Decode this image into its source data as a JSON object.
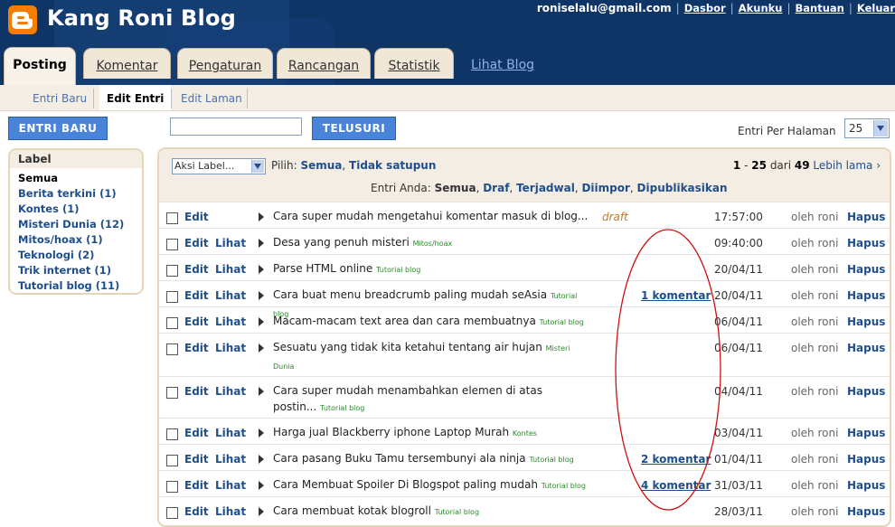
{
  "header": {
    "title": "Kang Roni Blog",
    "email": "roniselalu@gmail.com",
    "links": [
      "Dasbor",
      "Akunku",
      "Bantuan",
      "Keluar"
    ]
  },
  "tabs": [
    "Posting",
    "Komentar",
    "Pengaturan",
    "Rancangan",
    "Statistik"
  ],
  "view_blog": "Lihat Blog",
  "subnav": [
    "Entri Baru",
    "Edit Entri",
    "Edit Laman"
  ],
  "toolbar": {
    "new_post": "ENTRI BARU",
    "search_value": "",
    "search_button": "TELUSURI",
    "per_page_label": "Entri Per Halaman",
    "per_page_value": "25"
  },
  "labels": {
    "heading": "Label",
    "items": [
      "Semua",
      "Berita terkini (1)",
      "Kontes (1)",
      "Misteri Dunia (12)",
      "Mitos/hoax (1)",
      "Teknologi (2)",
      "Trik internet (1)",
      "Tutorial blog (11)"
    ]
  },
  "list_header": {
    "action_select": "Aksi Label...",
    "pilih_label": "Pilih:",
    "select_all": "Semua",
    "select_none": "Tidak satupun",
    "pager_range_start": "1",
    "pager_sep": "-",
    "pager_range_end": "25",
    "pager_of": "dari",
    "pager_total": "49",
    "pager_older": "Lebih lama ›",
    "filter_label": "Entri Anda:",
    "filter_all": "Semua",
    "filters": [
      "Draf",
      "Terjadwal",
      "Diimpor",
      "Dipublikasikan"
    ]
  },
  "actions": {
    "edit": "Edit",
    "view": "Lihat",
    "delete": "Hapus"
  },
  "posts": [
    {
      "title": "Cara super mudah mengetahui komentar masuk di blog...",
      "label": "",
      "status": "draft",
      "comments": "",
      "date": "17:57:00",
      "author": "oleh roni",
      "has_view": false
    },
    {
      "title": "Desa yang penuh misteri",
      "label": "Mitos/hoax",
      "status": "",
      "comments": "",
      "date": "09:40:00",
      "author": "oleh roni",
      "has_view": true
    },
    {
      "title": "Parse HTML online",
      "label": "Tutorial blog",
      "status": "",
      "comments": "",
      "date": "20/04/11",
      "author": "oleh roni",
      "has_view": true
    },
    {
      "title": "Cara buat menu breadcrumb paling mudah seAsia",
      "label": "Tutorial blog",
      "status": "",
      "comments": "1 komentar",
      "date": "20/04/11",
      "author": "oleh roni",
      "has_view": true
    },
    {
      "title": "Macam-macam text area dan cara membuatnya",
      "label": "Tutorial blog",
      "status": "",
      "comments": "",
      "date": "06/04/11",
      "author": "oleh roni",
      "has_view": true
    },
    {
      "title": "Sesuatu yang tidak kita ketahui tentang air hujan",
      "label": "Misteri Dunia",
      "status": "",
      "comments": "",
      "date": "06/04/11",
      "author": "oleh roni",
      "has_view": true
    },
    {
      "title": "Cara super mudah menambahkan elemen di atas postin...",
      "label": "Tutorial blog",
      "status": "",
      "comments": "",
      "date": "04/04/11",
      "author": "oleh roni",
      "has_view": true
    },
    {
      "title": "Harga jual Blackberry iphone Laptop Murah",
      "label": "Kontes",
      "status": "",
      "comments": "",
      "date": "03/04/11",
      "author": "oleh roni",
      "has_view": true
    },
    {
      "title": "Cara pasang Buku Tamu tersembunyi ala ninja",
      "label": "Tutorial blog",
      "status": "",
      "comments": "2 komentar",
      "date": "01/04/11",
      "author": "oleh roni",
      "has_view": true
    },
    {
      "title": "Cara Membuat Spoiler Di Blogspot paling mudah",
      "label": "Tutorial blog",
      "status": "",
      "comments": "4 komentar",
      "date": "31/03/11",
      "author": "oleh roni",
      "has_view": true
    },
    {
      "title": "Cara membuat kotak blogroll",
      "label": "Tutorial blog",
      "status": "",
      "comments": "",
      "date": "28/03/11",
      "author": "oleh roni",
      "has_view": true
    }
  ],
  "colors": {
    "header_bg": "#0f3567",
    "accent_orange": "#f57d00",
    "link_blue": "#1f4e8c",
    "button_blue": "#4a84d8",
    "label_green": "#2a8a2a",
    "annotation_red": "#cc1111"
  }
}
